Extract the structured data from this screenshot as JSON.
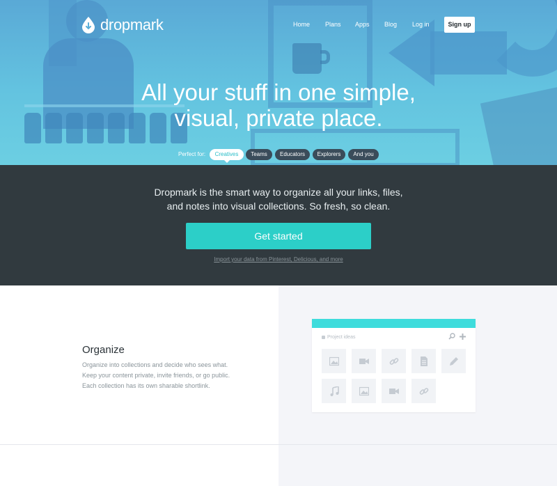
{
  "brand": {
    "name": "dropmark",
    "accent": "#2ccfc8",
    "card_accent": "#3edcdc",
    "dark_band": "#313a3f"
  },
  "nav": {
    "items": [
      "Home",
      "Plans",
      "Apps",
      "Blog",
      "Log in"
    ],
    "signup": "Sign up"
  },
  "hero": {
    "title_line1": "All your stuff in one simple,",
    "title_line2": "visual, private place.",
    "perfect_for_label": "Perfect for:",
    "audiences": [
      "Creatives",
      "Teams",
      "Educators",
      "Explorers",
      "And you"
    ],
    "active_audience": "Creatives"
  },
  "intro": {
    "line1": "Dropmark is the smart way to organize all your links, files,",
    "line2": "and notes into visual collections. So fresh, so clean.",
    "cta": "Get started",
    "import_link": "Import your data from Pinterest, Delicious, and more"
  },
  "feature": {
    "title": "Organize",
    "desc_line1": "Organize into collections and decide who sees what.",
    "desc_line2": "Keep your content private, invite friends, or go public.",
    "desc_line3": "Each collection has its own sharable shortlink.",
    "card": {
      "collection_name": "Project ideas",
      "tools": [
        "search-icon",
        "plus-icon"
      ],
      "tiles": [
        "image-icon",
        "video-icon",
        "link-icon",
        "document-icon",
        "pencil-icon",
        "music-icon",
        "image-icon",
        "video-icon",
        "link-icon"
      ]
    }
  }
}
